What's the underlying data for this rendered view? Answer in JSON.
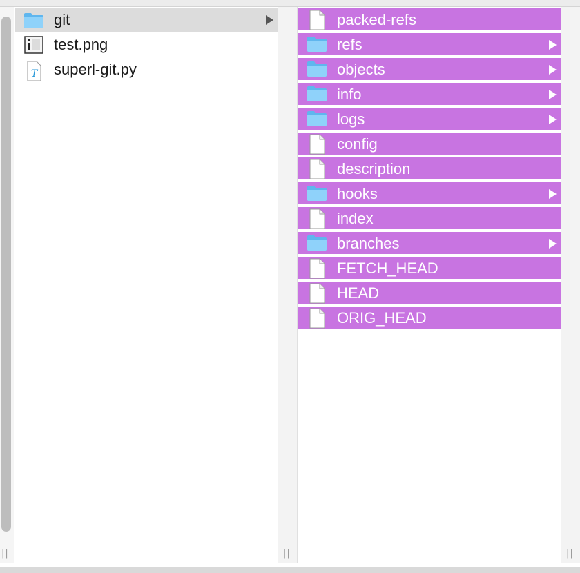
{
  "colors": {
    "selected_background": "#c874e1",
    "selected_text": "#ffffff",
    "folder_blue": "#7cc8f7",
    "highlight_gray": "#dcdcdc"
  },
  "column1": {
    "items": [
      {
        "label": "git",
        "kind": "folder",
        "icon": "folder-icon",
        "has_children": true,
        "highlighted": true
      },
      {
        "label": "test.png",
        "kind": "image",
        "icon": "image-file-icon",
        "has_children": false
      },
      {
        "label": "superl-git.py",
        "kind": "python",
        "icon": "python-file-icon",
        "has_children": false
      }
    ]
  },
  "column2": {
    "items": [
      {
        "label": "packed-refs",
        "kind": "file",
        "icon": "document-icon",
        "has_children": false
      },
      {
        "label": "refs",
        "kind": "folder",
        "icon": "folder-icon",
        "has_children": true
      },
      {
        "label": "objects",
        "kind": "folder",
        "icon": "folder-icon",
        "has_children": true
      },
      {
        "label": "info",
        "kind": "folder",
        "icon": "folder-icon",
        "has_children": true
      },
      {
        "label": "logs",
        "kind": "folder",
        "icon": "folder-icon",
        "has_children": true
      },
      {
        "label": "config",
        "kind": "file",
        "icon": "document-icon",
        "has_children": false
      },
      {
        "label": "description",
        "kind": "file",
        "icon": "document-icon",
        "has_children": false
      },
      {
        "label": "hooks",
        "kind": "folder",
        "icon": "folder-icon",
        "has_children": true
      },
      {
        "label": "index",
        "kind": "file",
        "icon": "document-icon",
        "has_children": false
      },
      {
        "label": "branches",
        "kind": "folder",
        "icon": "folder-icon",
        "has_children": true
      },
      {
        "label": "FETCH_HEAD",
        "kind": "file",
        "icon": "document-icon",
        "has_children": false
      },
      {
        "label": "HEAD",
        "kind": "file",
        "icon": "document-icon",
        "has_children": false
      },
      {
        "label": "ORIG_HEAD",
        "kind": "file",
        "icon": "document-icon",
        "has_children": false
      }
    ]
  }
}
